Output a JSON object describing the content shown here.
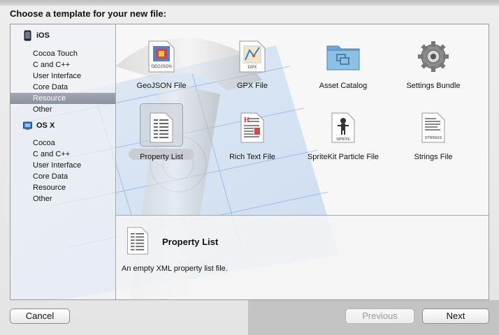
{
  "dialog": {
    "title": "Choose a template for your new file:"
  },
  "sidebar": {
    "groups": [
      {
        "label": "iOS",
        "icon": "iphone-icon",
        "items": [
          "Cocoa Touch",
          "C and C++",
          "User Interface",
          "Core Data",
          "Resource",
          "Other"
        ]
      },
      {
        "label": "OS X",
        "icon": "mac-finder-icon",
        "items": [
          "Cocoa",
          "C and C++",
          "User Interface",
          "Core Data",
          "Resource",
          "Other"
        ]
      }
    ],
    "selected": "iOS / Resource"
  },
  "templates": {
    "items": [
      {
        "label": "GeoJSON File",
        "icon": "geojson-file-icon",
        "icon_text": "GEOJSON"
      },
      {
        "label": "GPX File",
        "icon": "gpx-file-icon",
        "icon_text": "GPX"
      },
      {
        "label": "Asset Catalog",
        "icon": "folder-icon"
      },
      {
        "label": "Settings Bundle",
        "icon": "gear-icon"
      },
      {
        "label": "Property List",
        "icon": "property-list-icon"
      },
      {
        "label": "Rich Text File",
        "icon": "rich-text-file-icon"
      },
      {
        "label": "SpriteKit Particle File",
        "icon": "sprite-file-icon",
        "icon_text": "SPRITE"
      },
      {
        "label": "Strings File",
        "icon": "strings-file-icon",
        "icon_text": "STRINGS"
      }
    ],
    "selected": "Property List"
  },
  "detail": {
    "title": "Property List",
    "description": "An empty XML property list file."
  },
  "buttons": {
    "cancel": "Cancel",
    "previous": "Previous",
    "next": "Next"
  },
  "colors": {
    "selection": "#8a909d",
    "blueprint": "#3b6fb6"
  }
}
